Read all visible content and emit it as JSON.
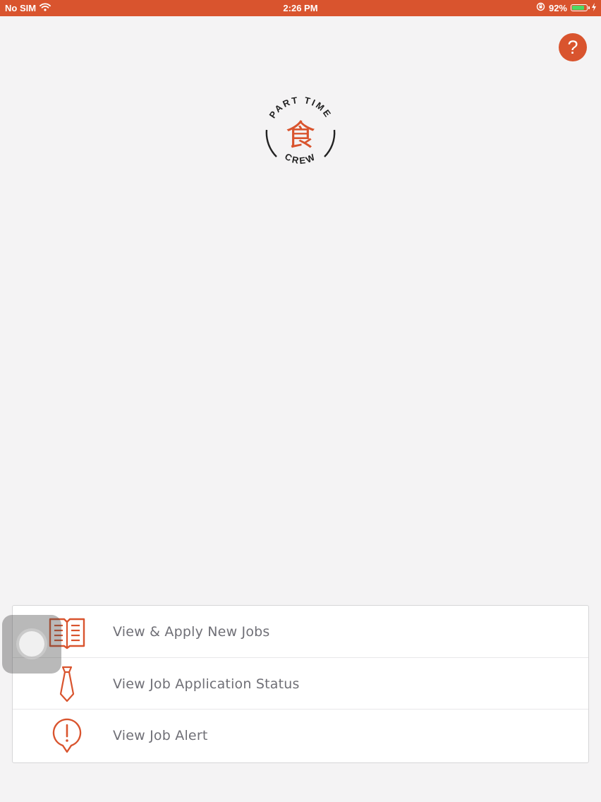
{
  "status_bar": {
    "carrier": "No SIM",
    "time": "2:26 PM",
    "battery_percent": "92%",
    "battery_level": 0.92,
    "wifi_icon": "wifi-icon",
    "orientation_icon": "orientation-lock-icon",
    "charging_icon": "lightning-icon"
  },
  "header": {
    "help_label": "?"
  },
  "logo": {
    "top_text": "PART TIME",
    "bottom_text": "CREW",
    "glyph": "食"
  },
  "menu": {
    "items": [
      {
        "label": "View & Apply New Jobs",
        "icon": "open-book-icon"
      },
      {
        "label": "View Job Application Status",
        "icon": "necktie-icon"
      },
      {
        "label": "View Job Alert",
        "icon": "alert-bubble-icon"
      }
    ]
  },
  "colors": {
    "accent": "#d9542e",
    "background": "#f4f3f4",
    "text_gray": "#6f6f76",
    "battery_green": "#4cd964"
  }
}
